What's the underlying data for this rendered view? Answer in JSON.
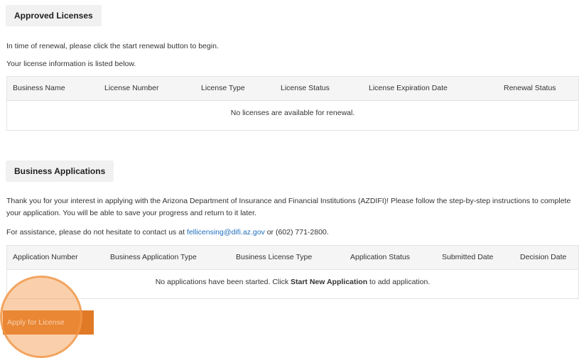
{
  "approved": {
    "title": "Approved Licenses",
    "intro1": "In time of renewal, please click the start renewal button to begin.",
    "intro2": "Your license information is listed below.",
    "columns": [
      "Business Name",
      "License Number",
      "License Type",
      "License Status",
      "License Expiration Date",
      "Renewal Status"
    ],
    "empty_text": "No licenses are available for renewal."
  },
  "applications": {
    "title": "Business Applications",
    "paragraph": "Thank you for your interest in applying with the Arizona Department of Insurance and Financial Institutions (AZDIFI)! Please follow the step-by-step instructions to complete your application. You will be able to save your progress and return to it later.",
    "assist_prefix": "For assistance, please do not hesitate to contact us at ",
    "assist_email": "fellicensing@difi.az.gov",
    "assist_suffix": " or (602) 771-2800.",
    "columns": [
      "Application Number",
      "Business Application Type",
      "Business License Type",
      "Application Status",
      "Submitted Date",
      "Decision Date"
    ],
    "empty_prefix": "No applications have been started. Click ",
    "empty_strong": "Start New Application",
    "empty_suffix": " to add application.",
    "apply_button": "Apply for License"
  },
  "colors": {
    "accent": "#e07a27",
    "link": "#1f6fbd",
    "header_bg": "#f5f5f5"
  }
}
